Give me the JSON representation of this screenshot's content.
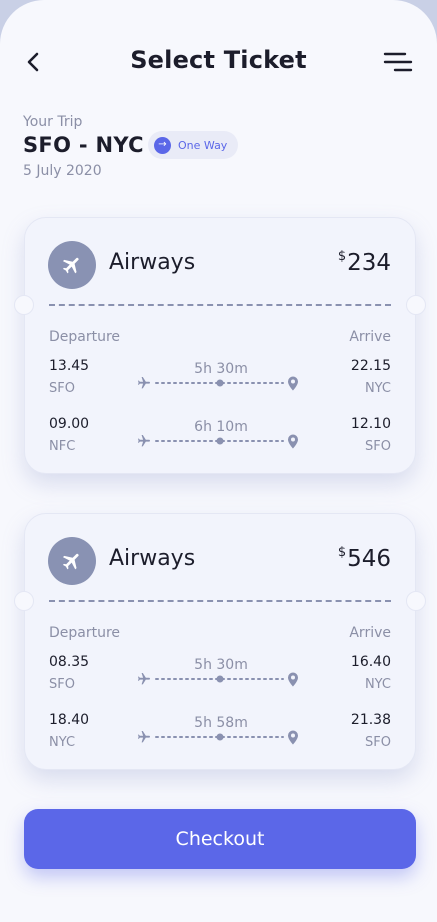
{
  "header": {
    "title": "Select Ticket"
  },
  "trip": {
    "label": "Your Trip",
    "route": "SFO - NYC",
    "date": "5 July 2020",
    "type": "One Way"
  },
  "labels": {
    "departure": "Departure",
    "arrive": "Arrive"
  },
  "tickets": [
    {
      "airline": "Airways",
      "currency": "$",
      "price": "234",
      "segments": [
        {
          "depart_time": "13.45",
          "depart_code": "SFO",
          "duration": "5h 30m",
          "arrive_time": "22.15",
          "arrive_code": "NYC"
        },
        {
          "depart_time": "09.00",
          "depart_code": "NFC",
          "duration": "6h 10m",
          "arrive_time": "12.10",
          "arrive_code": "SFO"
        }
      ]
    },
    {
      "airline": "Airways",
      "currency": "$",
      "price": "546",
      "segments": [
        {
          "depart_time": "08.35",
          "depart_code": "SFO",
          "duration": "5h 30m",
          "arrive_time": "16.40",
          "arrive_code": "NYC"
        },
        {
          "depart_time": "18.40",
          "depart_code": "NYC",
          "duration": "5h 58m",
          "arrive_time": "21.38",
          "arrive_code": "SFO"
        }
      ]
    }
  ],
  "checkout": {
    "label": "Checkout"
  },
  "colors": {
    "accent": "#5b67e8",
    "text": "#1c1d2b",
    "muted": "#8b8fa6",
    "icon_circle": "#8992b3",
    "card": "#f2f4fc"
  },
  "icons": {
    "back": "chevron-left-icon",
    "menu": "menu-icon",
    "one_way": "arrow-right-icon",
    "airline": "airplane-icon",
    "route_start": "airplane-icon",
    "route_end": "location-pin-icon"
  }
}
